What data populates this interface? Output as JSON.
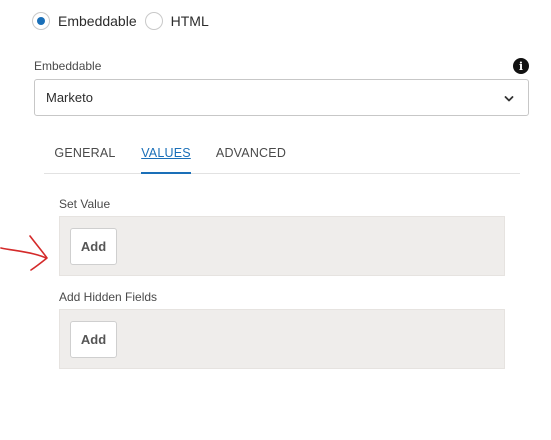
{
  "source_type": {
    "options": [
      {
        "label": "Embeddable",
        "checked": true
      },
      {
        "label": "HTML",
        "checked": false
      }
    ]
  },
  "embeddable": {
    "label": "Embeddable",
    "selected": "Marketo",
    "info_icon": "info-icon",
    "chevron_icon": "chevron-down-icon"
  },
  "tabs": [
    {
      "label": "GENERAL",
      "active": false
    },
    {
      "label": "VALUES",
      "active": true
    },
    {
      "label": "ADVANCED",
      "active": false
    }
  ],
  "set_value": {
    "label": "Set Value",
    "add_label": "Add"
  },
  "hidden_fields": {
    "label": "Add Hidden Fields",
    "add_label": "Add"
  },
  "annotation": {
    "icon": "red-arrow-icon",
    "color": "#d42a2a"
  },
  "colors": {
    "accent": "#1a6fb8",
    "panel": "#efedeb"
  }
}
